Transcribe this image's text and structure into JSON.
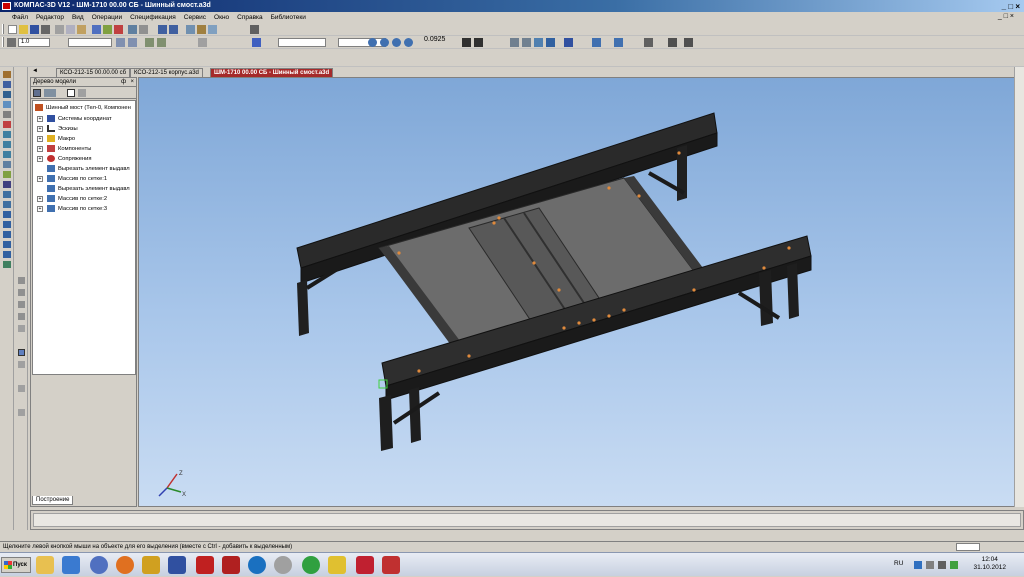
{
  "window": {
    "title": "КОМПАС-3D V12 - ШМ-1710 00.00 СБ - Шинный смост.a3d",
    "controls": "_ □ ×"
  },
  "menu": {
    "items": [
      "Файл",
      "Редактор",
      "Вид",
      "Операции",
      "Спецификация",
      "Сервис",
      "Окно",
      "Справка",
      "Библиотеки"
    ],
    "mdi_controls": "_ □ ×"
  },
  "toolbar": {
    "step_value": "1.0",
    "zoom_value": "0.0925"
  },
  "tabs": [
    {
      "label": "КСО-212-15 00.00.00 сб"
    },
    {
      "label": "КСО-212-15 корпус.a3d"
    },
    {
      "label": "ШМ-1710 00.00 СБ - Шинный смост.a3d"
    }
  ],
  "tree": {
    "header": "Дерево модели",
    "pin": "ф",
    "close": "×",
    "items": [
      {
        "label": "Шинный мост (Тел-0, Компонен",
        "expander": ""
      },
      {
        "label": "Системы координат",
        "expander": "+"
      },
      {
        "label": "Эскизы",
        "expander": "+"
      },
      {
        "label": "Макро",
        "expander": "+"
      },
      {
        "label": "Компоненты",
        "expander": "+"
      },
      {
        "label": "Сопряжения",
        "expander": "+"
      },
      {
        "label": "Вырезать элемент выдавл",
        "expander": ""
      },
      {
        "label": "Массив по сетке:1",
        "expander": "+"
      },
      {
        "label": "Вырезать элемент выдавл",
        "expander": ""
      },
      {
        "label": "Массив по сетке:2",
        "expander": "+"
      },
      {
        "label": "Массив по сетке:3",
        "expander": "+"
      }
    ],
    "bottom_tab": "Построение"
  },
  "viewport": {
    "axis_x": "X",
    "axis_z": "Z"
  },
  "status": {
    "message": "Щелкните левой кнопкой мыши на объекте для его выделения (вместе с Ctrl - добавить к выделенным)"
  },
  "taskbar": {
    "start_label": "Пуск",
    "language": "RU",
    "time": "12:04",
    "date": "31.10.2012"
  },
  "colors": {
    "title_gradient_start": "#0a246a",
    "active_tab": "#a52a2a",
    "viewport_top": "#7fa7d7",
    "model_dark": "#2b2b2b",
    "bolt_orange": "#e08a3c"
  }
}
